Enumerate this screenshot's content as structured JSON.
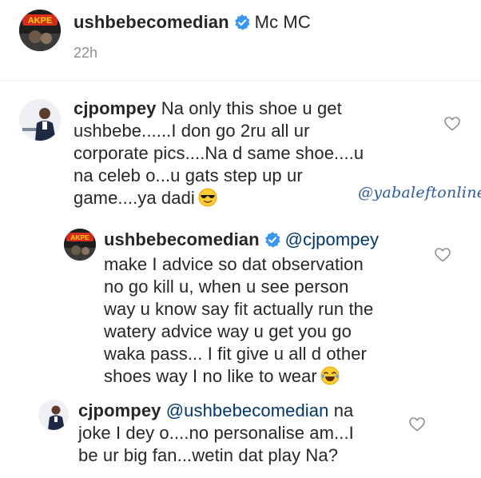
{
  "caption": {
    "username": "ushbebecomedian",
    "text": "Mc MC",
    "timestamp": "22h",
    "avatar_badge": "AKPE"
  },
  "comments": [
    {
      "username": "cjpompey",
      "mention": "",
      "text_lines": [
        "Na only this shoe u get",
        "ushbebe......I don go 2ru all ur",
        "corporate pics....Na d same shoe....u",
        "na celeb o...u gats step up ur",
        "game....ya dadi"
      ],
      "emoji": "smiling-face-with-sunglasses"
    },
    {
      "username": "ushbebecomedian",
      "mention": "@cjpompey",
      "text_lines": [
        "make I advice so dat observation",
        "no go kill u, when u see person",
        "way u know say fit actually run the",
        "watery advice way u get you go",
        "waka pass... I fit give u all d other",
        "shoes way I no like to wear"
      ],
      "emoji": "face-with-tears-of-joy"
    },
    {
      "username": "cjpompey",
      "mention": "@ushbebecomedian",
      "first_line_tail": "na",
      "text_lines": [
        "joke I dey o....no personalise am...I",
        "be ur big fan...wetin dat play Na?"
      ],
      "emoji": ""
    }
  ],
  "watermark": "@yabaleftonline",
  "colors": {
    "text": "#262626",
    "secondary": "#8e8e8e",
    "verified": "#3897f0",
    "divider": "#efefef"
  }
}
